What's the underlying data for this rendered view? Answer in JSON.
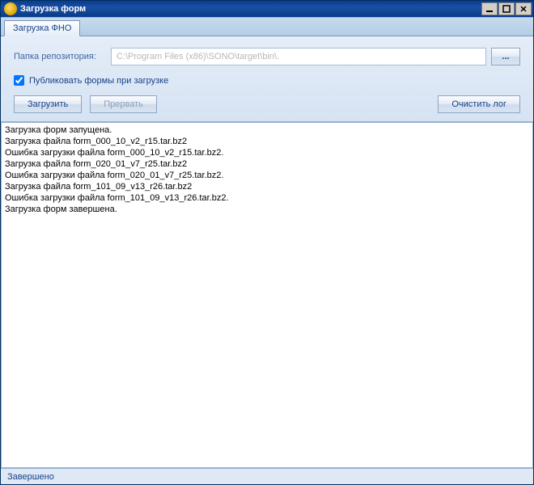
{
  "window": {
    "title": "Загрузка форм"
  },
  "tabs": {
    "main": "Загрузка ФНО"
  },
  "form": {
    "repo_label": "Папка репозитория:",
    "repo_path": "C:\\Program Files (x86)\\SONO\\target\\bin\\.",
    "browse_label": "...",
    "publish_label": "Публиковать формы при загрузке",
    "load_label": "Загрузить",
    "abort_label": "Прервать",
    "clear_label": "Очистить лог"
  },
  "log_lines": [
    "Загрузка форм запущена.",
    "Загрузка файла form_000_10_v2_r15.tar.bz2",
    "Ошибка загрузки файла form_000_10_v2_r15.tar.bz2.",
    "Загрузка файла form_020_01_v7_r25.tar.bz2",
    "Ошибка загрузки файла form_020_01_v7_r25.tar.bz2.",
    "Загрузка файла form_101_09_v13_r26.tar.bz2",
    "Ошибка загрузки файла form_101_09_v13_r26.tar.bz2.",
    "Загрузка форм завершена."
  ],
  "status": {
    "text": "Завершено"
  }
}
